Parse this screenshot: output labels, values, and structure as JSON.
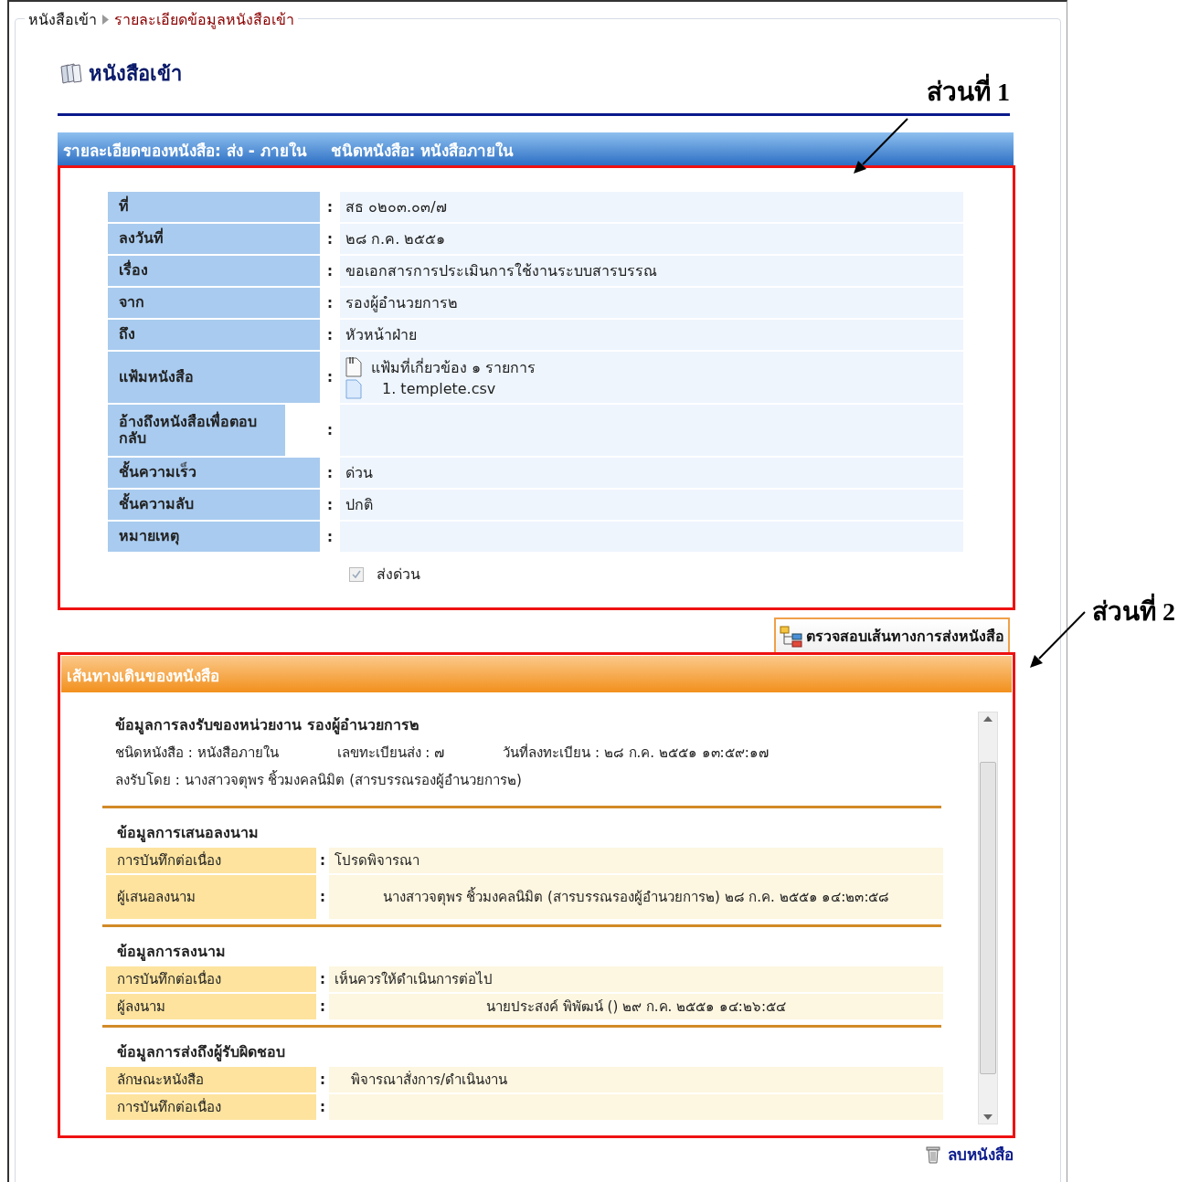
{
  "breadcrumb": [
    {
      "label": "หนังสือเข้า"
    },
    {
      "label": "รายละเอียดข้อมูลหนังสือเข้า"
    }
  ],
  "page_title": "หนังสือเข้า",
  "annotations": [
    {
      "label": "ส่วนที่ 1"
    },
    {
      "label": "ส่วนที่ 2"
    }
  ],
  "details": {
    "header": [
      "รายละเอียดของหนังสือ: ส่ง - ภายใน",
      "ชนิดหนังสือ: หนังสือภายใน"
    ],
    "rows": [
      {
        "kind": "text",
        "label": "ที่",
        "separator": ":",
        "value": "สธ ๐๒๐๓.๐๓/๗"
      },
      {
        "kind": "text",
        "label": "ลงวันที่",
        "separator": ":",
        "value": "๒๘ ก.ค. ๒๕๕๑"
      },
      {
        "kind": "text",
        "label": "เรื่อง",
        "separator": ":",
        "value": "ขอเอกสารการประเมินการใช้งานระบบสารบรรณ"
      },
      {
        "kind": "text",
        "label": "จาก",
        "separator": ":",
        "value": "รองผู้อำนวยการ๒"
      },
      {
        "kind": "text",
        "label": "ถึง",
        "separator": ":",
        "value": "หัวหน้าฝ่าย"
      },
      {
        "kind": "files",
        "label": "แฟ้มหนังสือ",
        "separator": ":",
        "summary": "แฟ้มที่เกี่ยวข้อง ๑ รายการ",
        "files": [
          "1. templete.csv"
        ]
      },
      {
        "kind": "wrapped",
        "label": "อ้างถึงหนังสือเพื่อตอบกลับ",
        "separator": ":"
      },
      {
        "kind": "text",
        "label": "ชั้นความเร็ว",
        "separator": ":",
        "value": "ด่วน"
      },
      {
        "kind": "text",
        "label": "ชั้นความลับ",
        "separator": ":",
        "value": "ปกติ"
      },
      {
        "kind": "text",
        "label": "หมายเหตุ",
        "separator": ":"
      }
    ],
    "urgent": {
      "label": "ส่งด่วน",
      "checked": true,
      "disabled": true
    }
  },
  "route_button": "ตรวจสอบเส้นทางการส่งหนังสือ",
  "route": {
    "header": "เส้นทางเดินของหนังสือ",
    "receipt": {
      "title": "ข้อมูลการลงรับของหน่วยงาน รองผู้อำนวยการ๒",
      "facts": [
        "ชนิดหนังสือ : หนังสือภายใน",
        "เลขทะเบียนส่ง : ๗",
        "วันที่ลงทะเบียน : ๒๘ ก.ค. ๒๕๕๑ ๑๓:๕๙:๑๗"
      ],
      "received_by": "ลงรับโดย :  นางสาวจตุพร ชิ้วมงคลนิมิต  (สารบรรณรองผู้อำนวยการ๒)"
    },
    "sections": [
      {
        "title": "ข้อมูลการเสนอลงนาม",
        "rows": [
          {
            "kind": "note",
            "label": "การบันทึกต่อเนื่อง",
            "separator": ":",
            "value": "โปรดพิจารณา"
          },
          {
            "kind": "signature",
            "label": "ผู้เสนอลงนาม",
            "separator": ":",
            "value": "นางสาวจตุพร ชิ้วมงคลนิมิต  (สารบรรณรองผู้อำนวยการ๒) ๒๘ ก.ค. ๒๕๕๑ ๑๔:๒๓:๕๘"
          }
        ]
      },
      {
        "title": "ข้อมูลการลงนาม",
        "rows": [
          {
            "kind": "note",
            "label": "การบันทึกต่อเนื่อง",
            "separator": ":",
            "value": "เห็นควรให้ดำเนินการต่อไป"
          },
          {
            "kind": "signature",
            "label": "ผู้ลงนาม",
            "separator": ":",
            "value": "นายประสงค์ พิพัฒน์  () ๒๙ ก.ค. ๒๕๕๑ ๑๔:๒๖:๕๔"
          }
        ]
      },
      {
        "title": "ข้อมูลการส่งถึงผู้รับผิดชอบ",
        "rows": [
          {
            "kind": "indented",
            "label": "ลักษณะหนังสือ",
            "separator": ":",
            "value": "พิจารณาสั่งการ/ดำเนินงาน"
          },
          {
            "kind": "note",
            "label": "การบันทึกต่อเนื่อง",
            "separator": ":"
          }
        ]
      }
    ]
  },
  "delete_link": "ลบหนังสือ"
}
